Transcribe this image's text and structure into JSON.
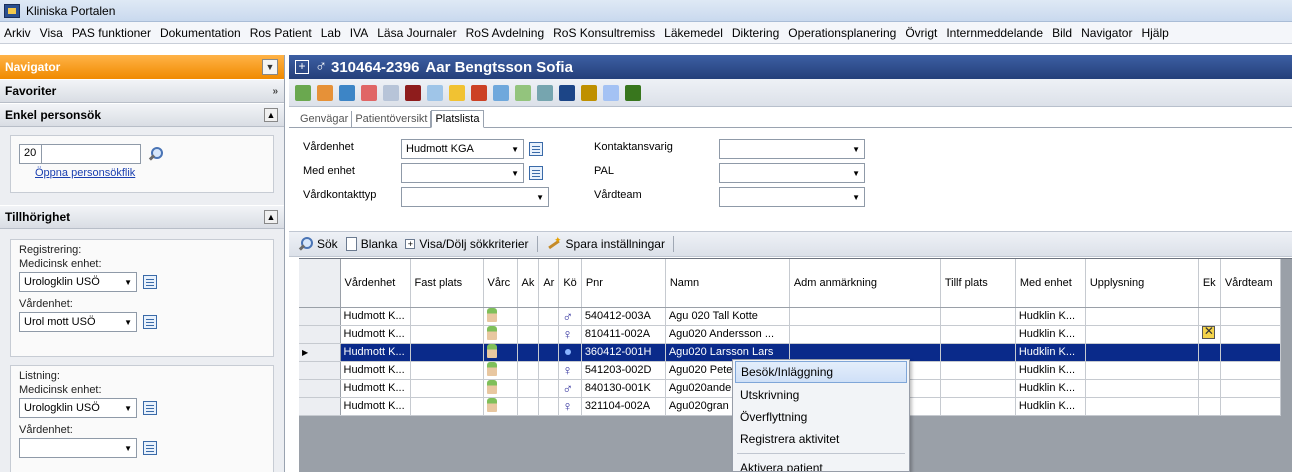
{
  "window": {
    "title": "Kliniska Portalen"
  },
  "menu": [
    "Arkiv",
    "Visa",
    "PAS funktioner",
    "Dokumentation",
    "Ros Patient",
    "Lab",
    "IVA",
    "Läsa Journaler",
    "RoS Avdelning",
    "RoS Konsultremiss",
    "Läkemedel",
    "Diktering",
    "Operationsplanering",
    "Övrigt",
    "Internmeddelande",
    "Bild",
    "Navigator",
    "Hjälp"
  ],
  "nav": {
    "header": "Navigator",
    "favoriter": "Favoriter",
    "enkel": {
      "title": "Enkel personsök",
      "prefix": "20",
      "link": "Öppna personsökflik"
    },
    "tillhorighet": {
      "title": "Tillhörighet",
      "registrering": {
        "label": "Registrering:",
        "med_label": "Medicinsk enhet:",
        "med_value": "Urologklin USÖ",
        "vard_label": "Vårdenhet:",
        "vard_value": "Urol mott USÖ"
      },
      "listning": {
        "label": "Listning:",
        "med_label": "Medicinsk enhet:",
        "med_value": "Urologklin USÖ",
        "vard_label": "Vårdenhet:",
        "vard_value": ""
      }
    }
  },
  "patient": {
    "id": "310464-2396",
    "name": "Aar Bengtsson Sofia"
  },
  "tabs": [
    "Genvägar",
    "Patientöversikt",
    "Platslista"
  ],
  "filters": {
    "vardenhet_label": "Vårdenhet",
    "vardenhet_value": "Hudmott KGA",
    "med_enhet_label": "Med enhet",
    "vardkontakttyp_label": "Vårdkontakttyp",
    "kontaktansvarig_label": "Kontaktansvarig",
    "pal_label": "PAL",
    "vardteam_label": "Vårdteam"
  },
  "actions": {
    "sok": "Sök",
    "blanka": "Blanka",
    "visa": "Visa/Dölj sökkriterier",
    "spara": "Spara inställningar"
  },
  "grid": {
    "headers": [
      "Vårdenhet",
      "Fast plats",
      "Vårc",
      "Ak",
      "Ar",
      "Kö",
      "Pnr",
      "Namn",
      "Adm anmärkning",
      "Tillf plats",
      "Med enhet",
      "Upplysning",
      "Ek",
      "Vårdteam"
    ],
    "rows": [
      {
        "vardenhet": "Hudmott K...",
        "gender": "♂",
        "pnr": "540412-003A",
        "namn": "Agu 020 Tall Kotte",
        "med": "Hudklin K...",
        "flag": false,
        "selected": false
      },
      {
        "vardenhet": "Hudmott K...",
        "gender": "♀",
        "pnr": "810411-002A",
        "namn": "Agu020 Andersson ...",
        "med": "Hudklin K...",
        "flag": true,
        "selected": false
      },
      {
        "vardenhet": "Hudmott K...",
        "gender": "",
        "pnr": "360412-001H",
        "namn": "Agu020 Larsson Lars",
        "med": "Hudklin K...",
        "flag": false,
        "selected": true
      },
      {
        "vardenhet": "Hudmott K...",
        "gender": "♀",
        "pnr": "541203-002D",
        "namn": "Agu020 Pete",
        "med": "Hudklin K...",
        "flag": false,
        "selected": false
      },
      {
        "vardenhet": "Hudmott K...",
        "gender": "♂",
        "pnr": "840130-001K",
        "namn": "Agu020ande",
        "med": "Hudklin K...",
        "flag": false,
        "selected": false
      },
      {
        "vardenhet": "Hudmott K...",
        "gender": "♀",
        "pnr": "321104-002A",
        "namn": "Agu020gran",
        "med": "Hudklin K...",
        "flag": false,
        "selected": false
      }
    ]
  },
  "context_menu": [
    "Besök/Inläggning",
    "Utskrivning",
    "Överflyttning",
    "Registrera aktivitet",
    "Aktivera patient"
  ],
  "colors": {
    "navigator_orange": "#f08a00",
    "patient_bar": "#243f7a",
    "selected_row": "#0a2a8a"
  }
}
